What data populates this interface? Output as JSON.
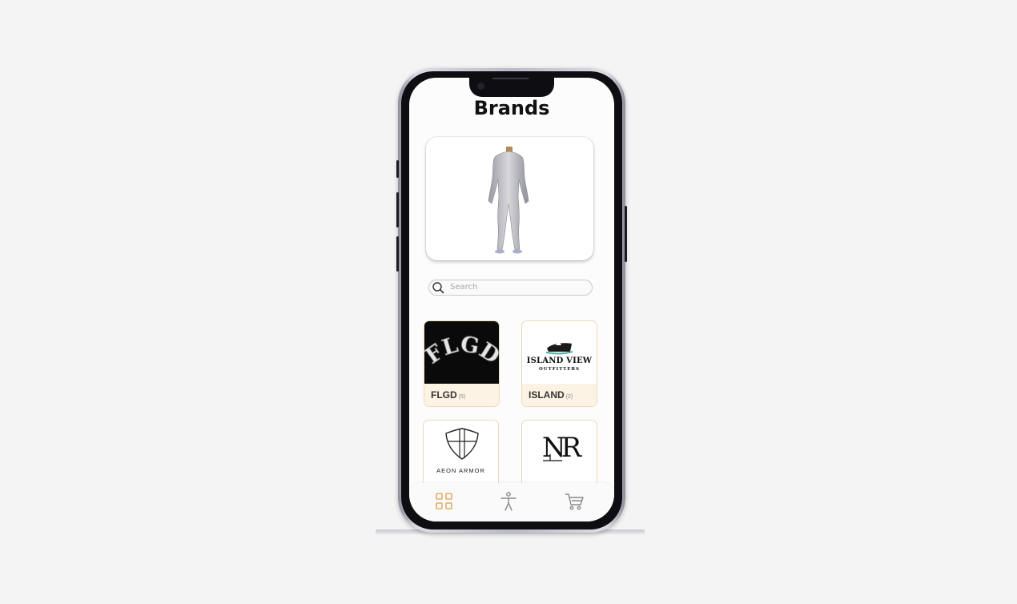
{
  "page": {
    "title": "Brands"
  },
  "avatar": {
    "icon": "body-model-icon"
  },
  "search": {
    "placeholder": "Search",
    "value": ""
  },
  "brands": [
    {
      "logo_text": "FLGD",
      "name": "FLGD",
      "count": "(5)"
    },
    {
      "logo_text": "ISLAND VIEW",
      "logo_subtext": "OUTFITTERS",
      "name": "ISLAND",
      "count": "(2)"
    },
    {
      "logo_text": "AEON ARMOR",
      "name": "",
      "count": ""
    },
    {
      "logo_text": "NR",
      "name": "",
      "count": ""
    }
  ],
  "tabbar": {
    "items": [
      {
        "icon": "grid-icon",
        "active": true
      },
      {
        "icon": "person-icon",
        "active": false
      },
      {
        "icon": "cart-icon",
        "active": false
      }
    ]
  },
  "colors": {
    "accent": "#e2ad66",
    "card_border": "#f0d9b8",
    "label_bg": "#fdf3e4"
  }
}
